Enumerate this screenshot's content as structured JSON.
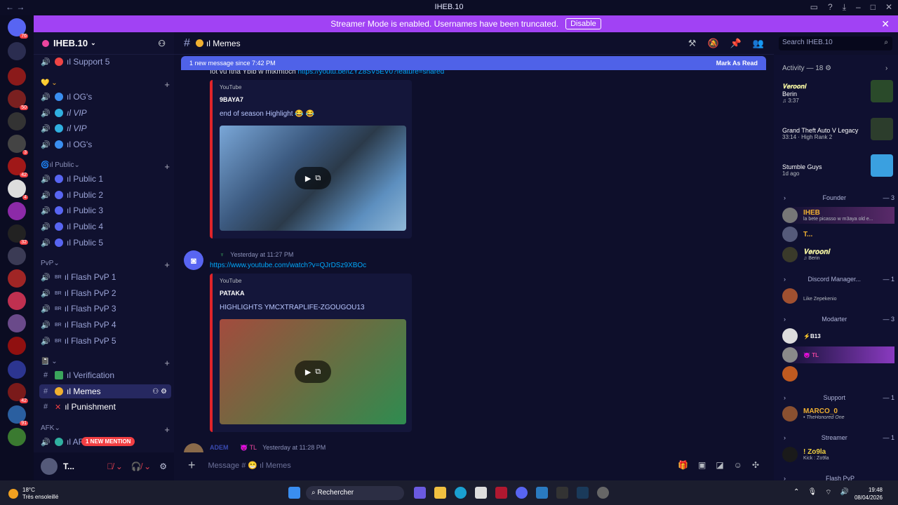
{
  "window": {
    "title": "IHEB.10",
    "nav_back": "←",
    "nav_forward": "→"
  },
  "banner": {
    "text": "Streamer Mode is enabled. Usernames have been truncated.",
    "button": "Disable",
    "close": "✕"
  },
  "server": {
    "name": "IHEB.10"
  },
  "sidebar": {
    "top_channel": "ıl Support 5",
    "group1": [
      {
        "label": "ıl OG's"
      },
      {
        "label": "ıl VIP"
      },
      {
        "label": "ıl VIP"
      },
      {
        "label": "ıl OG's"
      }
    ],
    "public_category": "ıl Public",
    "public": [
      {
        "label": "ıl Public 1"
      },
      {
        "label": "ıl Public 2"
      },
      {
        "label": "ıl Public 3"
      },
      {
        "label": "ıl Public 4"
      },
      {
        "label": "ıl Public 5"
      }
    ],
    "pvp_category": "PvP",
    "pvp": [
      {
        "label": "ıl Flash PvP 1"
      },
      {
        "label": "ıl Flash PvP 2"
      },
      {
        "label": "ıl Flash PvP 3"
      },
      {
        "label": "ıl Flash PvP 4"
      },
      {
        "label": "ıl Flash PvP 5"
      }
    ],
    "text": [
      {
        "label": "ıl Verification"
      },
      {
        "label": "ıl Memes"
      },
      {
        "label": "ıl Punishment"
      }
    ],
    "afk_category": "AFK",
    "afk_channel": "ıl AF",
    "mention_badge": "1 NEW MENTION"
  },
  "user": {
    "name": "T..."
  },
  "chat": {
    "channel": "ıl Memes",
    "new_messages": "1 new message since 7:42 PM",
    "mark_read": "Mark As Read",
    "top_link": "https://youtu.be/iZYZ8SV5EV0?feature=shared",
    "top_link_prefix": "fot vu ftna Ybib w mtkmtoch",
    "embed1": {
      "provider": "YouTube",
      "author": "9BAYA7",
      "title": "end of season Highlight 😂 😂"
    },
    "msg2": {
      "time": "Yesterday at 11:27 PM",
      "link": "https://www.youtube.com/watch?v=QJrDSz9XBOc"
    },
    "embed2": {
      "provider": "YouTube",
      "author": "PATAKA",
      "title": "HIGHLIGHTS YMCXTRAPLIFE-ZGOUGOU13"
    },
    "msg3": {
      "name": "ADEM",
      "tag": "TL",
      "time": "Yesterday at 11:28 PM"
    },
    "composer_placeholder": "Message # 😁 ıl Memes"
  },
  "search": {
    "placeholder": "Search IHEB.10"
  },
  "members": {
    "activity_title": "Activity — 18 ⚙",
    "activities": [
      {
        "name": "𝐕𝐞𝐫𝐨𝐨𝐧𝐢",
        "game": "Berin",
        "detail": "♫ 3:37"
      },
      {
        "name": "",
        "game": "Grand Theft Auto V Legacy",
        "detail": "33:14 · High Rank 2"
      },
      {
        "name": "",
        "game": "Stumble Guys",
        "detail": "1d ago"
      }
    ],
    "founder_title": "Founder",
    "founder_count": "— 3",
    "founder": [
      {
        "name": "IHEB",
        "status": "la bete picasso w m3aya old e..."
      },
      {
        "name": "T...",
        "status": ""
      },
      {
        "name": "𝐕𝐞𝐫𝐨𝐨𝐧𝐢",
        "status": "♫ Berin"
      }
    ],
    "dm_title": "Discord Manager...",
    "dm_count": "— 1",
    "dm": [
      {
        "name": "",
        "status": "Like Zepekenio"
      }
    ],
    "mod_title": "Modarter",
    "mod_count": "— 3",
    "mod": [
      {
        "name": "B13"
      },
      {
        "name": "TL"
      },
      {
        "name": ""
      }
    ],
    "support_title": "Support",
    "support_count": "— 1",
    "support": [
      {
        "name": "MARCO_0",
        "status": "• TheHonored One"
      }
    ],
    "streamer_title": "Streamer",
    "streamer_count": "— 1",
    "streamer": [
      {
        "name": "! Zo9la",
        "status": "Kick : Zo9la"
      }
    ],
    "flash_title": "Flash PvP"
  },
  "taskbar": {
    "temp": "18°C",
    "weather": "Très ensoleillé",
    "search": "Rechercher",
    "time": "19:48",
    "date": "08/04/2026"
  },
  "colors": {
    "accent": "#5865f2",
    "banner": "#a142f4",
    "youtube": "#e0242a"
  }
}
